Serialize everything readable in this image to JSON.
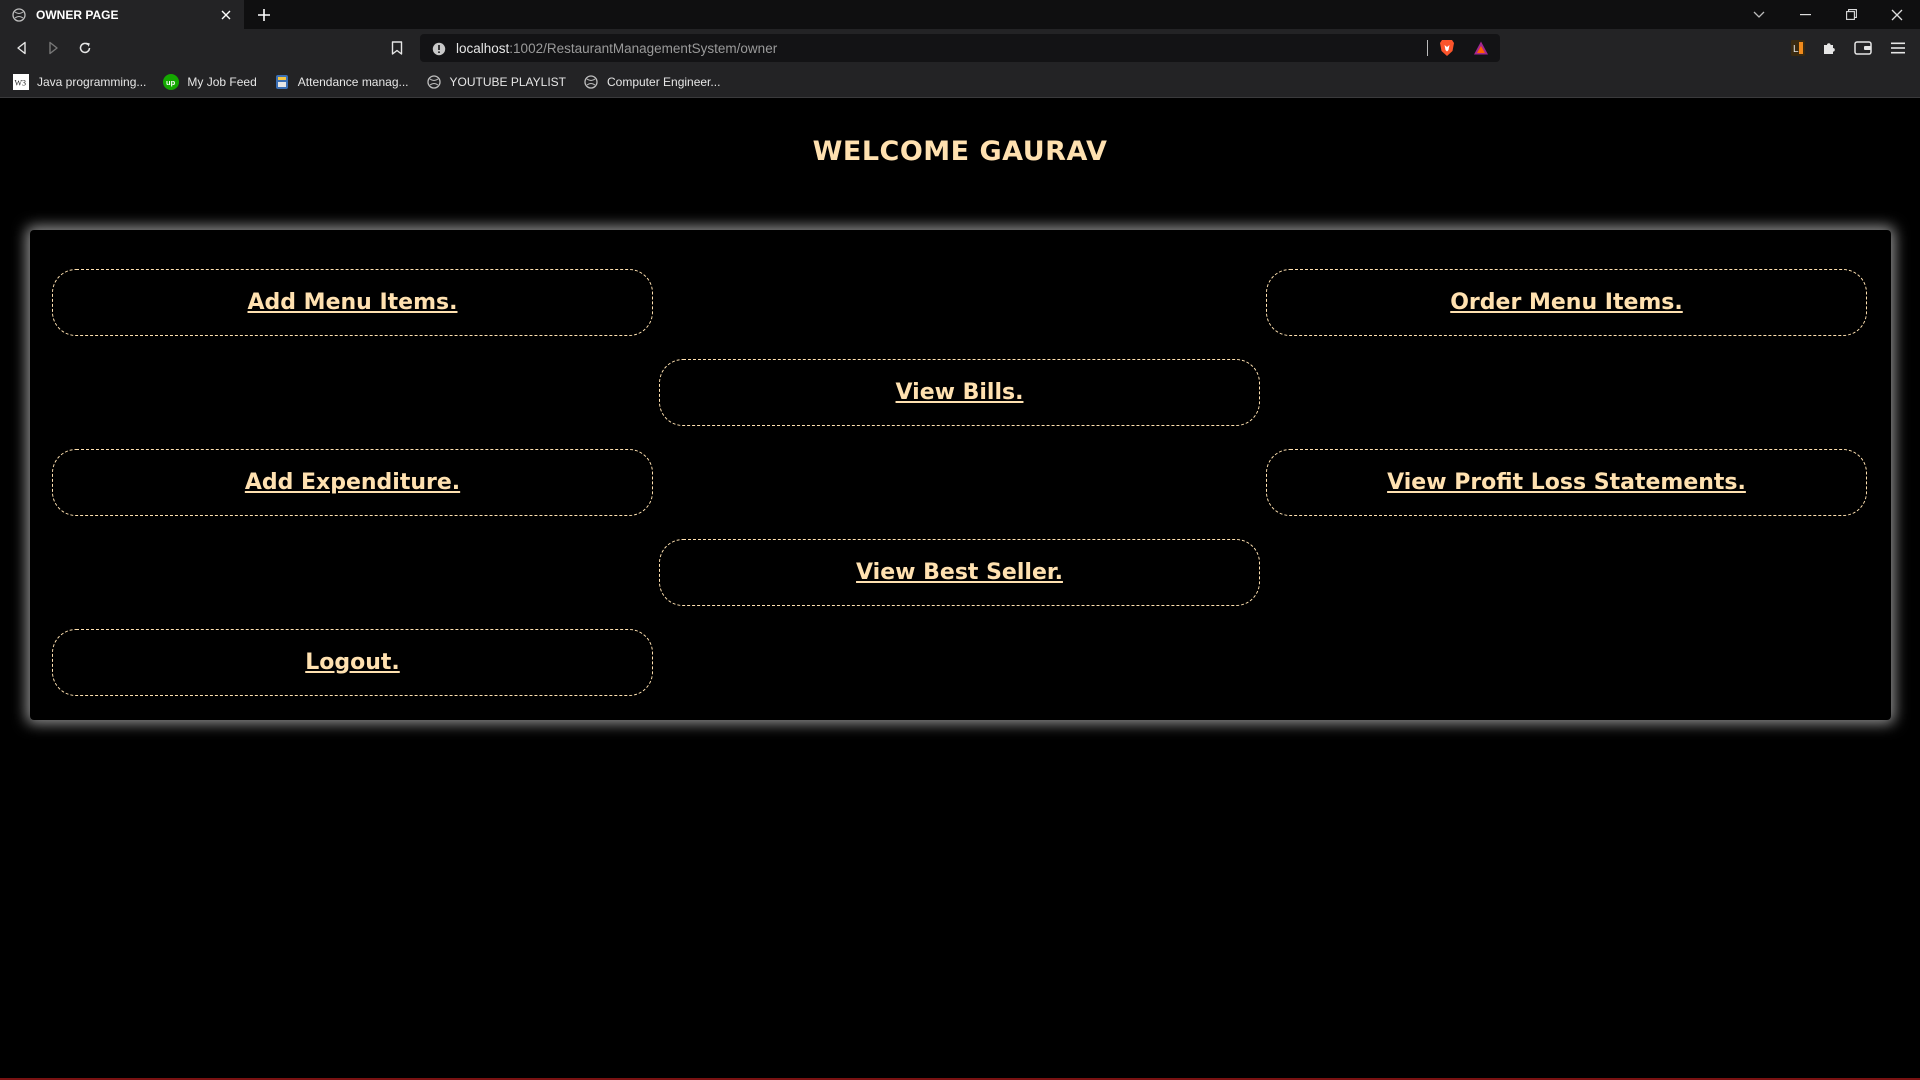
{
  "browser": {
    "tab": {
      "title": "OWNER PAGE"
    },
    "address": {
      "host": "localhost",
      "path": ":1002/RestaurantManagementSystem/owner"
    },
    "bookmarks": [
      {
        "label": "Java programming...",
        "icon": "wiki-icon"
      },
      {
        "label": "My Job Feed",
        "icon": "upwork-icon"
      },
      {
        "label": "Attendance manag...",
        "icon": "app-icon"
      },
      {
        "label": "YOUTUBE PLAYLIST",
        "icon": "globe-icon"
      },
      {
        "label": "Computer Engineer...",
        "icon": "globe-icon"
      }
    ],
    "extension_badge": "L"
  },
  "page": {
    "welcome": "WELCOME GAURAV",
    "actions": {
      "add_menu": "Add Menu Items.",
      "order_menu": "Order Menu Items.",
      "view_bills": "View Bills.",
      "add_expenditure": "Add Expenditure.",
      "profit_loss": "View Profit Loss Statements.",
      "best_seller": "View Best Seller.",
      "logout": "Logout."
    }
  },
  "colors": {
    "accent": "#ffe1b0",
    "background": "#000000",
    "chrome": "#232325"
  }
}
